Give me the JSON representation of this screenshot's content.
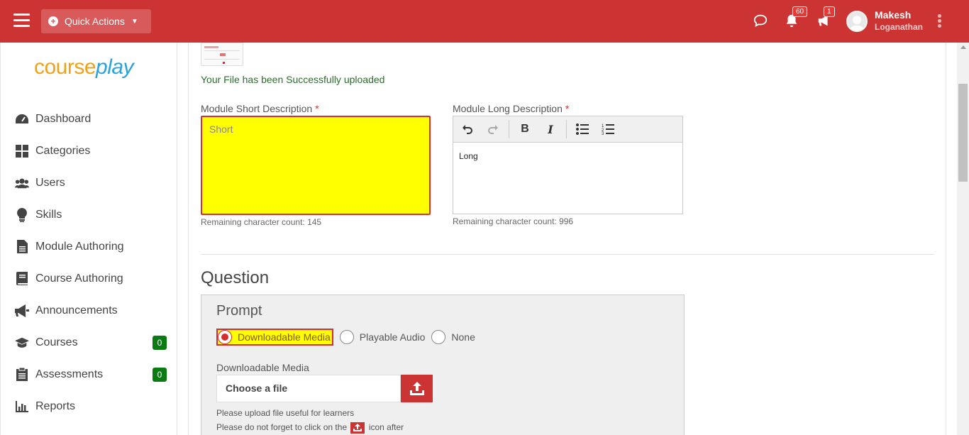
{
  "header": {
    "quick_actions_label": "Quick Actions",
    "notifications_count": "60",
    "announcements_count": "1",
    "user_first_name": "Makesh",
    "user_last_name": "Loganathan",
    "brand_color": "#cc3333"
  },
  "sidebar": {
    "logo_part1": "course",
    "logo_part2": "play",
    "items": [
      {
        "label": "Dashboard",
        "icon": "dashboard-icon"
      },
      {
        "label": "Categories",
        "icon": "grid-icon"
      },
      {
        "label": "Users",
        "icon": "users-icon"
      },
      {
        "label": "Skills",
        "icon": "lightbulb-icon"
      },
      {
        "label": "Module Authoring",
        "icon": "file-icon"
      },
      {
        "label": "Course Authoring",
        "icon": "book-icon"
      },
      {
        "label": "Announcements",
        "icon": "megaphone-icon"
      },
      {
        "label": "Courses",
        "icon": "graduation-cap-icon",
        "count": "0"
      },
      {
        "label": "Assessments",
        "icon": "clipboard-icon",
        "count": "0"
      },
      {
        "label": "Reports",
        "icon": "bar-chart-icon"
      }
    ]
  },
  "main": {
    "upload_success": "Your File has been Successfully uploaded",
    "short_desc_label": "Module Short Description",
    "short_desc_required": "*",
    "short_desc_value": "Short",
    "short_desc_remaining": "Remaining character count: 145",
    "long_desc_label": "Module Long Description",
    "long_desc_required": "*",
    "long_desc_value": "Long",
    "long_desc_remaining": "Remaining character count: 996",
    "question_title": "Question",
    "prompt": {
      "title": "Prompt",
      "options": [
        "Downloadable Media",
        "Playable Audio",
        "None"
      ],
      "selected": "Downloadable Media",
      "media_label": "Downloadable Media",
      "file_placeholder": "Choose a file",
      "help_line1": "Please upload file useful for learners",
      "help_line2_pre": "Please do not forget to click on the",
      "help_line2_post": "icon after"
    }
  }
}
